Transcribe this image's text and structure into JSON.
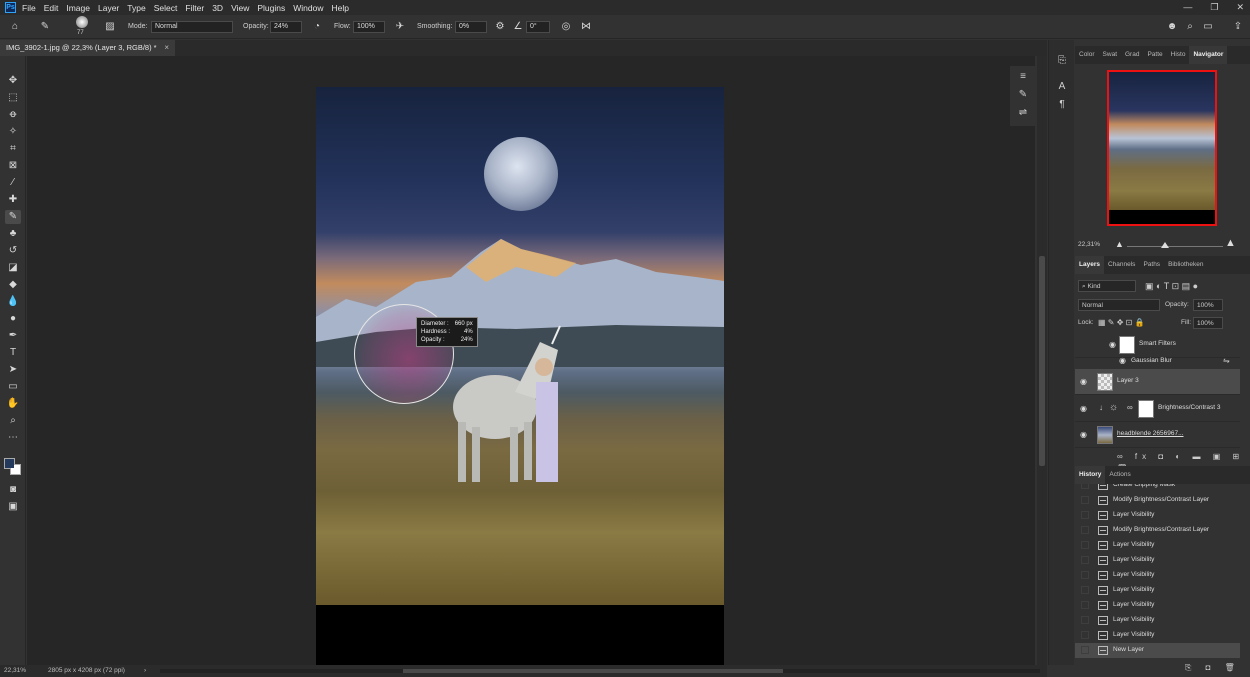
{
  "app": {
    "logo": "Ps",
    "menu": [
      "File",
      "Edit",
      "Image",
      "Layer",
      "Type",
      "Select",
      "Filter",
      "3D",
      "View",
      "Plugins",
      "Window",
      "Help"
    ],
    "window_controls": [
      "—",
      "❐",
      "✕"
    ]
  },
  "options": {
    "brush_size": "77",
    "mode_label": "Mode:",
    "mode_value": "Normal",
    "opacity_label": "Opacity:",
    "opacity_value": "24%",
    "flow_label": "Flow:",
    "flow_value": "100%",
    "smoothing_label": "Smoothing:",
    "smoothing_value": "0%",
    "angle_value": "0°"
  },
  "document": {
    "tab_title": "IMG_3902-1.jpg @ 22,3% (Layer 3, RGB/8) *",
    "tab_close": "×"
  },
  "brush_tooltip": {
    "diameter_label": "Diameter :",
    "diameter_value": "660 px",
    "hardness_label": "Hardness :",
    "hardness_value": "4%",
    "opacity_label": "Opacity :",
    "opacity_value": "24%"
  },
  "status": {
    "zoom": "22,31%",
    "doc_info": "2805 px x 4208 px (72 ppi)",
    "arrow": "›"
  },
  "navigator": {
    "tabs": [
      "Color",
      "Swat",
      "Grad",
      "Patte",
      "Histo",
      "Navigator"
    ],
    "active_tab": "Navigator",
    "zoom": "22,31%"
  },
  "layers": {
    "tabs": [
      "Layers",
      "Channels",
      "Paths",
      "Bibliotheken"
    ],
    "filter_kind": "Kind",
    "blend_mode": "Normal",
    "opacity_label": "Opacity:",
    "opacity_value": "100%",
    "lock_label": "Lock:",
    "fill_label": "Fill:",
    "fill_value": "100%",
    "items": [
      {
        "name": "Smart Filters"
      },
      {
        "name": "Gaussian Blur"
      },
      {
        "name": "Layer 3"
      },
      {
        "name": "Brightness/Contrast 3"
      },
      {
        "name": "headblende 2656967..."
      }
    ]
  },
  "history": {
    "tabs": [
      "History",
      "Actions"
    ],
    "items": [
      "Create Clipping Mask",
      "Modify Brightness/Contrast Layer",
      "Layer Visibility",
      "Modify Brightness/Contrast Layer",
      "Layer Visibility",
      "Layer Visibility",
      "Layer Visibility",
      "Layer Visibility",
      "Layer Visibility",
      "Layer Visibility",
      "Layer Visibility",
      "New Layer"
    ],
    "selected": "New Layer"
  },
  "colors": {
    "foreground": "#243a5c",
    "background": "#ffffff",
    "navigator_frame": "#ee1111"
  }
}
